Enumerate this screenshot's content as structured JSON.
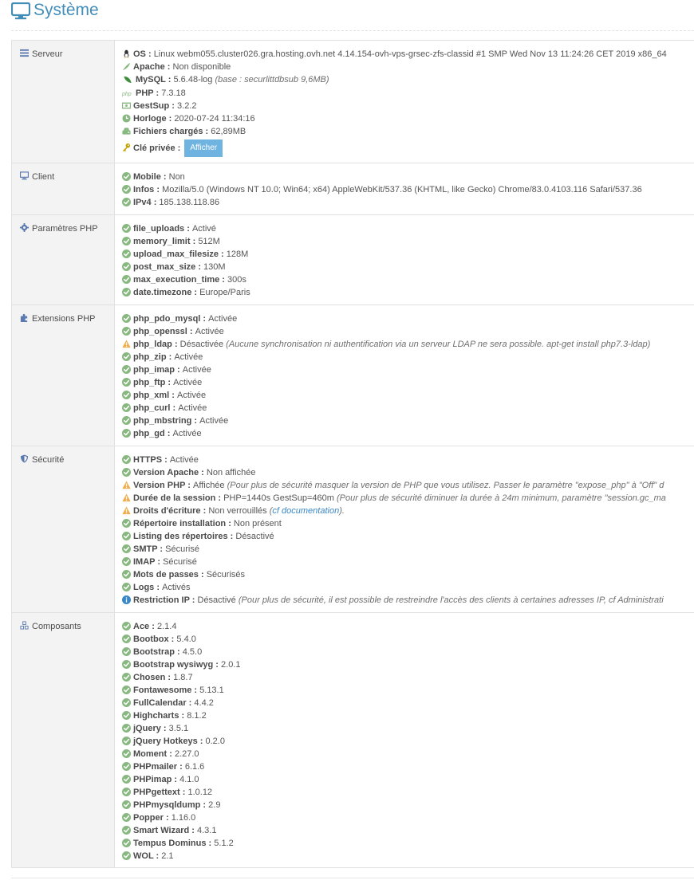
{
  "page": {
    "title": "Système"
  },
  "colors": {
    "ok": "#87b87f",
    "warn": "#f0ad4e",
    "info": "#3a87c8",
    "title": "#438eb9"
  },
  "serveur": {
    "label": "Serveur",
    "os": {
      "key": "OS",
      "value": "Linux webm055.cluster026.gra.hosting.ovh.net 4.14.154-ovh-vps-grsec-zfs-classid #1 SMP Wed Nov 13 11:24:26 CET 2019 x86_64"
    },
    "apache": {
      "key": "Apache",
      "value": "Non disponible"
    },
    "mysql": {
      "key": "MySQL",
      "value": "5.6.48-log",
      "note": "(base : securlittdbsub 9,6MB)"
    },
    "php": {
      "key": "PHP",
      "value": "7.3.18"
    },
    "gestsup": {
      "key": "GestSup",
      "value": "3.2.2"
    },
    "horloge": {
      "key": "Horloge",
      "value": "2020-07-24 11:34:16"
    },
    "fichiers": {
      "key": "Fichiers chargés",
      "value": "62,89MB"
    },
    "cle": {
      "key": "Clé privée",
      "button": "Afficher"
    }
  },
  "client": {
    "label": "Client",
    "rows": [
      {
        "key": "Mobile",
        "value": "Non"
      },
      {
        "key": "Infos",
        "value": "Mozilla/5.0 (Windows NT 10.0; Win64; x64) AppleWebKit/537.36 (KHTML, like Gecko) Chrome/83.0.4103.116 Safari/537.36"
      },
      {
        "key": "IPv4",
        "value": "185.138.118.86"
      }
    ]
  },
  "php_params": {
    "label": "Paramètres PHP",
    "rows": [
      {
        "key": "file_uploads",
        "value": "Activé"
      },
      {
        "key": "memory_limit",
        "value": "512M"
      },
      {
        "key": "upload_max_filesize",
        "value": "128M"
      },
      {
        "key": "post_max_size",
        "value": "130M"
      },
      {
        "key": "max_execution_time",
        "value": "300s"
      },
      {
        "key": "date.timezone",
        "value": "Europe/Paris"
      }
    ]
  },
  "php_ext": {
    "label": "Extensions PHP",
    "rows": [
      {
        "status": "ok",
        "key": "php_pdo_mysql",
        "value": "Activée"
      },
      {
        "status": "ok",
        "key": "php_openssl",
        "value": "Activée"
      },
      {
        "status": "warn",
        "key": "php_ldap",
        "value": "Désactivée",
        "note": "(Aucune synchronisation ni authentification via un serveur LDAP ne sera possible. apt-get install php7.3-ldap)"
      },
      {
        "status": "ok",
        "key": "php_zip",
        "value": "Activée"
      },
      {
        "status": "ok",
        "key": "php_imap",
        "value": "Activée"
      },
      {
        "status": "ok",
        "key": "php_ftp",
        "value": "Activée"
      },
      {
        "status": "ok",
        "key": "php_xml",
        "value": "Activée"
      },
      {
        "status": "ok",
        "key": "php_curl",
        "value": "Activée"
      },
      {
        "status": "ok",
        "key": "php_mbstring",
        "value": "Activée"
      },
      {
        "status": "ok",
        "key": "php_gd",
        "value": "Activée"
      }
    ]
  },
  "securite": {
    "label": "Sécurité",
    "rows": [
      {
        "status": "ok",
        "key": "HTTPS",
        "value": "Activée"
      },
      {
        "status": "ok",
        "key": "Version Apache",
        "value": "Non affichée"
      },
      {
        "status": "warn",
        "key": "Version PHP",
        "value": "Affichée",
        "note": "(Pour plus de sécurité masquer la version de PHP que vous utilisez. Passer le paramètre \"expose_php\" à \"Off\" d"
      },
      {
        "status": "warn",
        "key": "Durée de la session",
        "value": "PHP=1440s GestSup=460m",
        "note": "(Pour plus de sécurité diminuer la durée à 24m minimum, paramètre \"session.gc_ma"
      },
      {
        "status": "warn",
        "key": "Droits d'écriture",
        "value": "Non verrouillés",
        "note": "(",
        "link": "cf documentation",
        "note_end": ")."
      },
      {
        "status": "ok",
        "key": "Répertoire installation",
        "value": "Non présent"
      },
      {
        "status": "ok",
        "key": "Listing des répertoires",
        "value": "Désactivé"
      },
      {
        "status": "ok",
        "key": "SMTP",
        "value": "Sécurisé"
      },
      {
        "status": "ok",
        "key": "IMAP",
        "value": "Sécurisé"
      },
      {
        "status": "ok",
        "key": "Mots de passes",
        "value": "Sécurisés"
      },
      {
        "status": "ok",
        "key": "Logs",
        "value": "Activés"
      },
      {
        "status": "info",
        "key": "Restriction IP",
        "value": "Désactivé",
        "note": "(Pour plus de sécurité, il est possible de restreindre l'accès des clients à certaines adresses IP, cf Administrati"
      }
    ]
  },
  "composants": {
    "label": "Composants",
    "rows": [
      {
        "key": "Ace",
        "value": "2.1.4"
      },
      {
        "key": "Bootbox",
        "value": "5.4.0"
      },
      {
        "key": "Bootstrap",
        "value": "4.5.0"
      },
      {
        "key": "Bootstrap wysiwyg",
        "value": "2.0.1"
      },
      {
        "key": "Chosen",
        "value": "1.8.7"
      },
      {
        "key": "Fontawesome",
        "value": "5.13.1"
      },
      {
        "key": "FullCalendar",
        "value": "4.4.2"
      },
      {
        "key": "Highcharts",
        "value": "8.1.2"
      },
      {
        "key": "jQuery",
        "value": "3.5.1"
      },
      {
        "key": "jQuery Hotkeys",
        "value": "0.2.0"
      },
      {
        "key": "Moment",
        "value": "2.27.0"
      },
      {
        "key": "PHPmailer",
        "value": "6.1.6"
      },
      {
        "key": "PHPimap",
        "value": "4.1.0"
      },
      {
        "key": "PHPgettext",
        "value": "1.0.12"
      },
      {
        "key": "PHPmysqldump",
        "value": "2.9"
      },
      {
        "key": "Popper",
        "value": "1.16.0"
      },
      {
        "key": "Smart Wizard",
        "value": "4.3.1"
      },
      {
        "key": "Tempus Dominus",
        "value": "5.1.2"
      },
      {
        "key": "WOL",
        "value": "2.1"
      }
    ]
  }
}
